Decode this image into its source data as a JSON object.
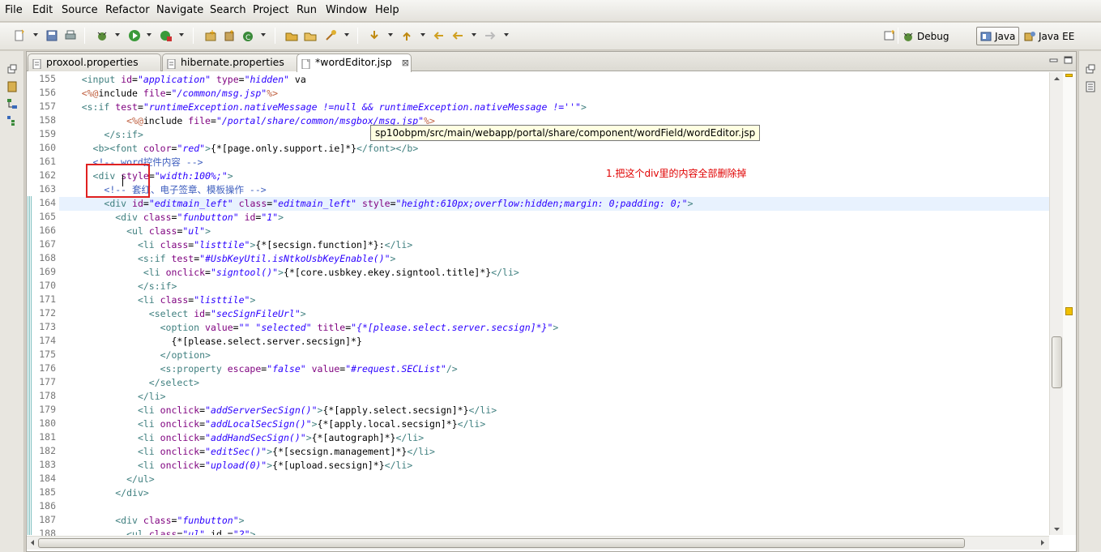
{
  "menu": [
    "File",
    "Edit",
    "Source",
    "Refactor",
    "Navigate",
    "Search",
    "Project",
    "Run",
    "Window",
    "Help"
  ],
  "perspectives": [
    {
      "label": "Debug",
      "icon": "bug-icon",
      "active": false
    },
    {
      "label": "Java",
      "icon": "java-perspective-icon",
      "active": true
    },
    {
      "label": "Java EE",
      "icon": "javaee-perspective-icon",
      "active": false
    }
  ],
  "tabs": [
    {
      "label": "proxool.properties",
      "icon": "properties-file-icon",
      "active": false
    },
    {
      "label": "hibernate.properties",
      "icon": "properties-file-icon",
      "active": false
    },
    {
      "label": "*wordEditor.jsp",
      "icon": "jsp-file-icon",
      "active": true,
      "close": "⊠"
    }
  ],
  "tooltip": "sp10obpm/src/main/webapp/portal/share/component/wordField/wordEditor.jsp",
  "annotation": "1.把这个div里的内容全部删除掉",
  "current_line": 164,
  "code_lines": [
    {
      "n": "155",
      "text": "    <input id=\"application\" type=\"hidden\" va"
    },
    {
      "n": "156",
      "text": "    <%@include file=\"/common/msg.jsp\"%>"
    },
    {
      "n": "157",
      "text": "    <s:if test=\"runtimeException.nativeMessage !=null && runtimeException.nativeMessage !=''\">"
    },
    {
      "n": "158",
      "text": "            <%@include file=\"/portal/share/common/msgbox/msg.jsp\"%>"
    },
    {
      "n": "159",
      "text": "        </s:if>"
    },
    {
      "n": "160",
      "text": "      <b><font color=\"red\">{*[page.only.support.ie]*}</font></b>"
    },
    {
      "n": "161",
      "text": "      <!-- word控件内容 -->"
    },
    {
      "n": "162",
      "text": "      <div style=\"width:100%;\">"
    },
    {
      "n": "163",
      "text": "        <!-- 套红、电子签章、模板操作 -->"
    },
    {
      "n": "164",
      "text": "        <div id=\"editmain_left\" class=\"editmain_left\" style=\"height:610px;overflow:hidden;margin: 0;padding: 0;\">"
    },
    {
      "n": "165",
      "text": "          <div class=\"funbutton\" id=\"1\">"
    },
    {
      "n": "166",
      "text": "            <ul class=\"ul\">"
    },
    {
      "n": "167",
      "text": "              <li class=\"listtile\">{*[secsign.function]*}:</li>"
    },
    {
      "n": "168",
      "text": "              <s:if test=\"#UsbKeyUtil.isNtkoUsbKeyEnable()\">"
    },
    {
      "n": "169",
      "text": "               <li onclick=\"signtool()\">{*[core.usbkey.ekey.signtool.title]*}</li>"
    },
    {
      "n": "170",
      "text": "              </s:if>"
    },
    {
      "n": "171",
      "text": "              <li class=\"listtile\">"
    },
    {
      "n": "172",
      "text": "                <select id=\"secSignFileUrl\">"
    },
    {
      "n": "173",
      "text": "                  <option value=\"\" \"selected\" title=\"{*[please.select.server.secsign]*}\">"
    },
    {
      "n": "174",
      "text": "                    {*[please.select.server.secsign]*}"
    },
    {
      "n": "175",
      "text": "                  </option>"
    },
    {
      "n": "176",
      "text": "                  <s:property escape=\"false\" value=\"#request.SECList\"/>"
    },
    {
      "n": "177",
      "text": "                </select>"
    },
    {
      "n": "178",
      "text": "              </li>"
    },
    {
      "n": "179",
      "text": "              <li onclick=\"addServerSecSign()\">{*[apply.select.secsign]*}</li>"
    },
    {
      "n": "180",
      "text": "              <li onclick=\"addLocalSecSign()\">{*[apply.local.secsign]*}</li>"
    },
    {
      "n": "181",
      "text": "              <li onclick=\"addHandSecSign()\">{*[autograph]*}</li>"
    },
    {
      "n": "182",
      "text": "              <li onclick=\"editSec()\">{*[secsign.management]*}</li>"
    },
    {
      "n": "183",
      "text": "              <li onclick=\"upload(0)\">{*[upload.secsign]*}</li>"
    },
    {
      "n": "184",
      "text": "            </ul>"
    },
    {
      "n": "185",
      "text": "          </div>"
    },
    {
      "n": "186",
      "text": ""
    },
    {
      "n": "187",
      "text": "          <div class=\"funbutton\">"
    },
    {
      "n": "188",
      "text": "            <ul class=\"ul\" id =\"2\">"
    }
  ],
  "colors": {
    "tag": "#3f7f7f",
    "attribute": "#7f007f",
    "value": "#2a00ff",
    "comment": "#3f5fbf",
    "scriptlet": "#bf5f3f",
    "annotation": "#e00000"
  }
}
